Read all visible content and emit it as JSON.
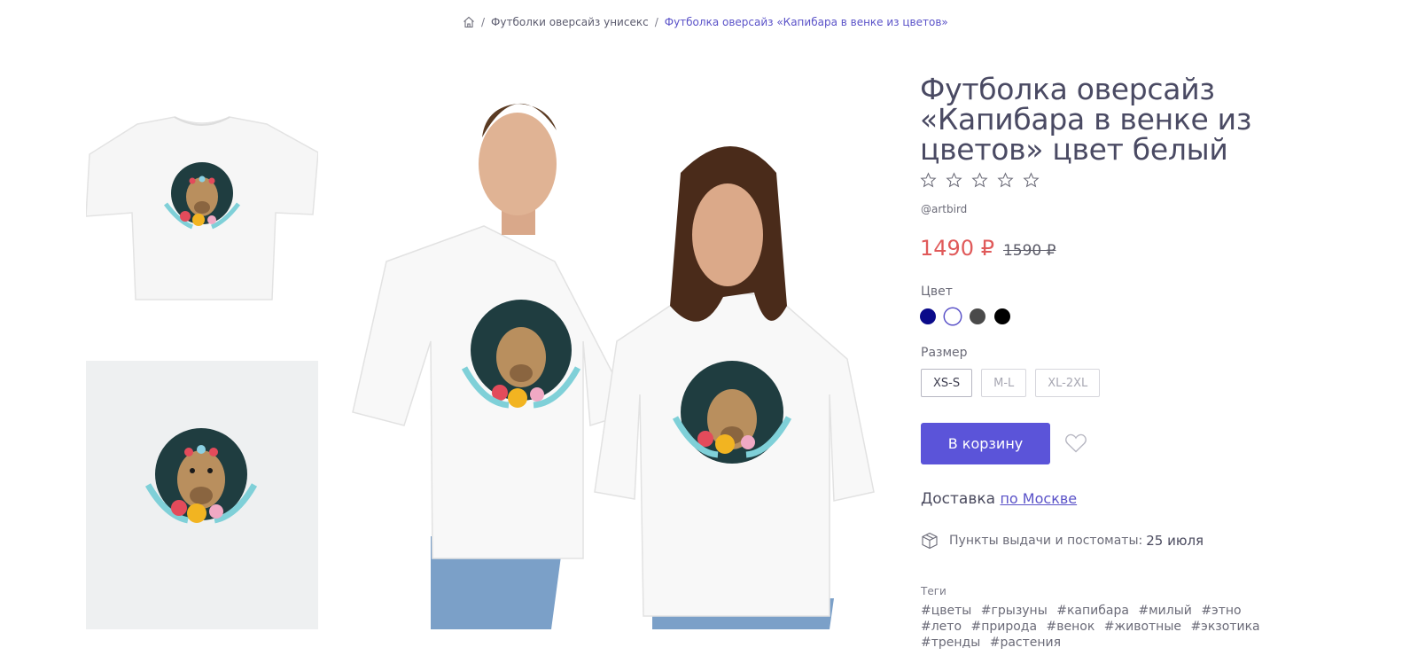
{
  "breadcrumb": {
    "home_icon": "home-icon",
    "items": [
      "Футболки оверсайз унисекс",
      "Футболка оверсайз «Капибара в венке из цветов»"
    ]
  },
  "product": {
    "title": "Футболка оверсайз «Капибара в венке из цветов» цвет белый",
    "rating": {
      "value": 0,
      "max": 5
    },
    "author": "@artbird",
    "price": "1490 ₽",
    "old_price": "1590 ₽"
  },
  "color": {
    "label": "Цвет",
    "options": [
      "#0a0a8a",
      "#ffffff",
      "#4a4a4a",
      "#000000"
    ],
    "selected_index": 1
  },
  "size": {
    "label": "Размер",
    "options": [
      "XS-S",
      "M-L",
      "XL-2XL"
    ],
    "selected": "XS-S"
  },
  "actions": {
    "cart_label": "В корзину",
    "favorite_icon": "heart-icon"
  },
  "delivery": {
    "label": "Доставка",
    "link": "по Москве",
    "pickup_label": "Пункты выдачи и постоматы:",
    "pickup_date": "25 июля",
    "pickup_icon": "box-icon"
  },
  "tags": {
    "label": "Теги",
    "items": [
      "#цветы",
      "#грызуны",
      "#капибара",
      "#милый",
      "#этно",
      "#лето",
      "#природа",
      "#венок",
      "#животные",
      "#экзотика",
      "#тренды",
      "#растения"
    ]
  },
  "colors": {
    "accent": "#5b54d9",
    "price": "#e05a5a"
  }
}
